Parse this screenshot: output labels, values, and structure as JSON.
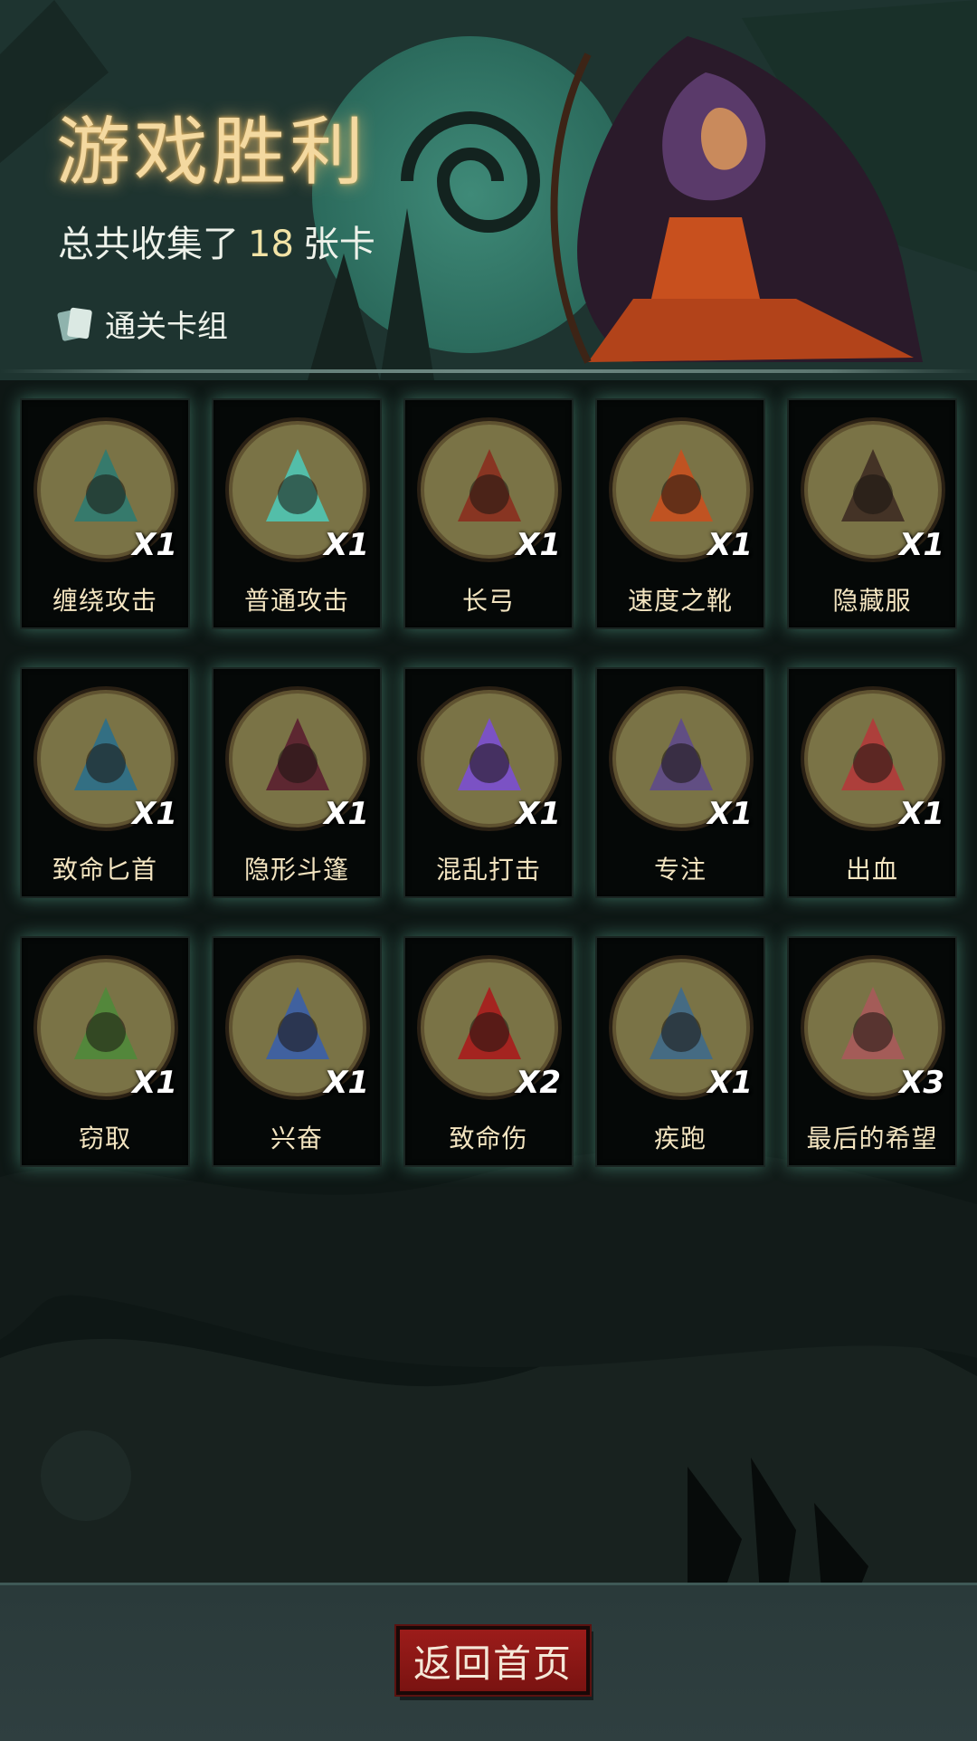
{
  "header": {
    "title": "游戏胜利",
    "subtitle_prefix": "总共收集了",
    "card_total": "18",
    "subtitle_suffix": "张卡",
    "deck_link_label": "通关卡组"
  },
  "cards": [
    {
      "name": "缠绕攻击",
      "count": "X1",
      "icon": "thorn-vine-icon"
    },
    {
      "name": "普通攻击",
      "count": "X1",
      "icon": "arrow-strike-icon"
    },
    {
      "name": "长弓",
      "count": "X1",
      "icon": "longbow-icon"
    },
    {
      "name": "速度之靴",
      "count": "X1",
      "icon": "speed-boot-icon"
    },
    {
      "name": "隐藏服",
      "count": "X1",
      "icon": "hood-cloak-icon"
    },
    {
      "name": "致命匕首",
      "count": "X1",
      "icon": "dagger-icon"
    },
    {
      "name": "隐形斗篷",
      "count": "X1",
      "icon": "invisible-cloak-icon"
    },
    {
      "name": "混乱打击",
      "count": "X1",
      "icon": "chaos-strike-icon"
    },
    {
      "name": "专注",
      "count": "X1",
      "icon": "wizard-focus-icon"
    },
    {
      "name": "出血",
      "count": "X1",
      "icon": "bleed-creature-icon"
    },
    {
      "name": "窃取",
      "count": "X1",
      "icon": "goblin-chest-icon"
    },
    {
      "name": "兴奋",
      "count": "X1",
      "icon": "dwarf-hammer-icon"
    },
    {
      "name": "致命伤",
      "count": "X2",
      "icon": "bloody-knife-icon"
    },
    {
      "name": "疾跑",
      "count": "X1",
      "icon": "werewolf-sprint-icon"
    },
    {
      "name": "最后的希望",
      "count": "X3",
      "icon": "girl-hope-icon"
    }
  ],
  "footer": {
    "home_button_label": "返回首页"
  },
  "colors": {
    "title_glow": "#f4d9a0",
    "card_frame_glow": "#6ed2b4",
    "medallion_fill": "#7a7346",
    "button_red": "#9c1c1a"
  }
}
